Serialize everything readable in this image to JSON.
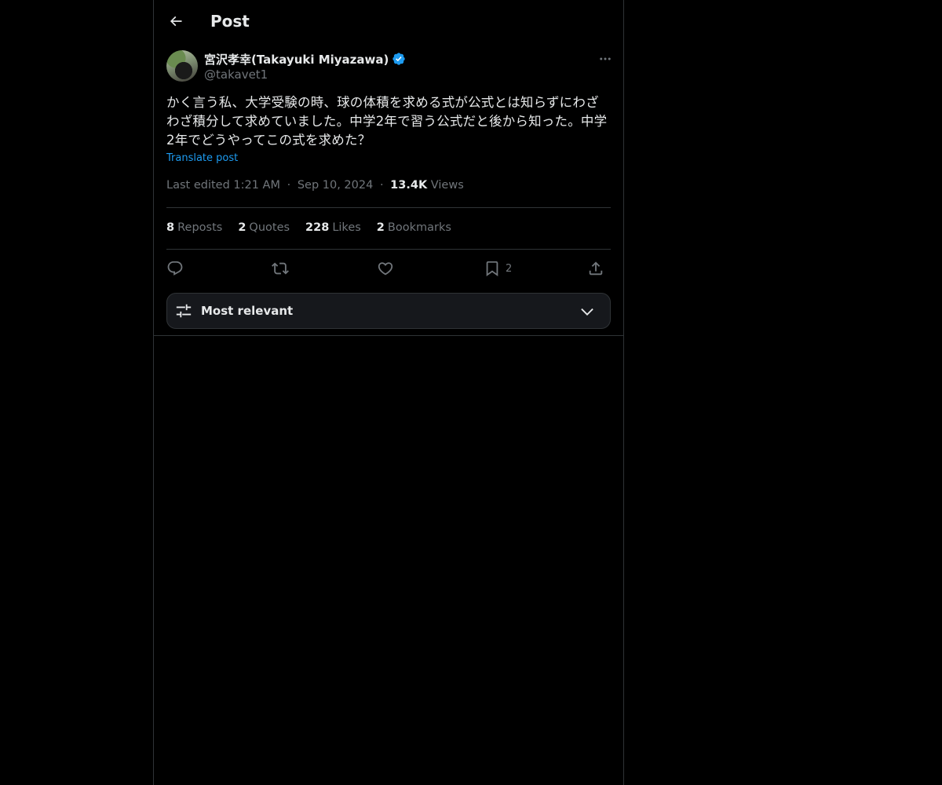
{
  "header": {
    "title": "Post",
    "back_icon": "arrow-left-icon"
  },
  "author": {
    "name": "宮沢孝幸(Takayuki Miyazawa)",
    "handle": "@takavet1",
    "verified": true,
    "verified_color": "#1d9bf0"
  },
  "tweet": {
    "text": "かく言う私、大学受験の時、球の体積を求める式が公式とは知らずにわざわざ積分して求めていました。中学2年で習う公式だと後から知った。中学2年でどうやってこの式を求めた？",
    "translate_label": "Translate post",
    "edited_label": "Last edited 1:21 AM",
    "date": "Sep 10, 2024",
    "separator": "·",
    "views_count": "13.4K",
    "views_label": "Views"
  },
  "stats": [
    {
      "num": "8",
      "label": "Reposts"
    },
    {
      "num": "2",
      "label": "Quotes"
    },
    {
      "num": "228",
      "label": "Likes"
    },
    {
      "num": "2",
      "label": "Bookmarks"
    }
  ],
  "actions": {
    "reply_icon": "reply-icon",
    "repost_icon": "repost-icon",
    "like_icon": "heart-icon",
    "bookmark_icon": "bookmark-icon",
    "bookmark_count": "2",
    "share_icon": "share-icon"
  },
  "sort": {
    "label": "Most relevant"
  },
  "colors": {
    "background": "#000000",
    "text": "#e7e9ea",
    "secondary": "#71767b",
    "accent": "#1d9bf0",
    "border": "#2f3336"
  }
}
